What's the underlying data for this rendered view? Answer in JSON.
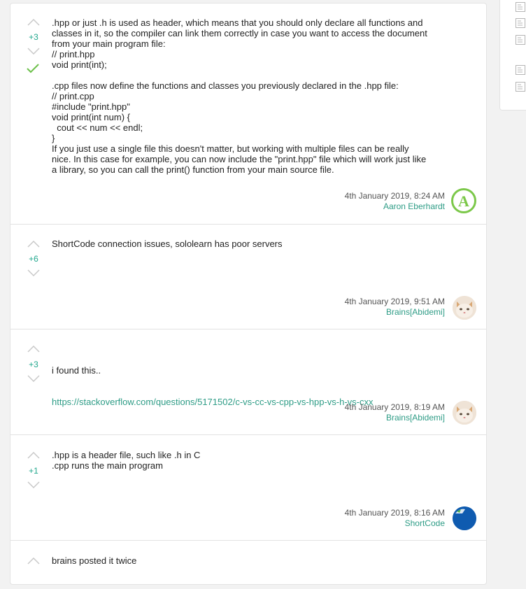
{
  "answers": [
    {
      "votes": "+3",
      "accepted": true,
      "body": ".hpp or just .h is used as header, which means that you should only declare all functions and\nclasses in it, so the compiler can link them correctly in case you want to access the document\nfrom your main program file:\n// print.hpp\nvoid print(int);\n\n.cpp files now define the functions and classes you previously declared in the .hpp file:\n// print.cpp\n#include \"print.hpp\"\nvoid print(int num) {\n  cout << num << endl;\n}\nIf you just use a single file this doesn't matter, but working with multiple files can be really\nnice. In this case for example, you can now include the \"print.hpp\" file which will work just like\na library, so you can call the print() function from your main source file.",
      "date": "4th January 2019, 8:24 AM",
      "author": "Aaron Eberhardt",
      "avatar_letter": "A"
    },
    {
      "votes": "+6",
      "accepted": false,
      "body": "ShortCode connection issues, sololearn has poor servers",
      "date": "4th January 2019, 9:51 AM",
      "author": "Brains[Abidemi]"
    },
    {
      "votes": "+3",
      "accepted": false,
      "body": "i found this..",
      "link": "https://stackoverflow.com/questions/5171502/c-vs-cc-vs-cpp-vs-hpp-vs-h-vs-cxx",
      "date": "4th January 2019, 8:19 AM",
      "author": "Brains[Abidemi]"
    },
    {
      "votes": "+1",
      "accepted": false,
      "body": ".hpp is a header file, such like .h in C\n.cpp runs the main program",
      "date": "4th January 2019, 8:16 AM",
      "author": "ShortCode"
    },
    {
      "body": "brains posted it twice"
    }
  ],
  "colors": {
    "accent": "#2e9c86",
    "accepted_check": "#6cc04a",
    "vote_count": "#22a88e"
  }
}
